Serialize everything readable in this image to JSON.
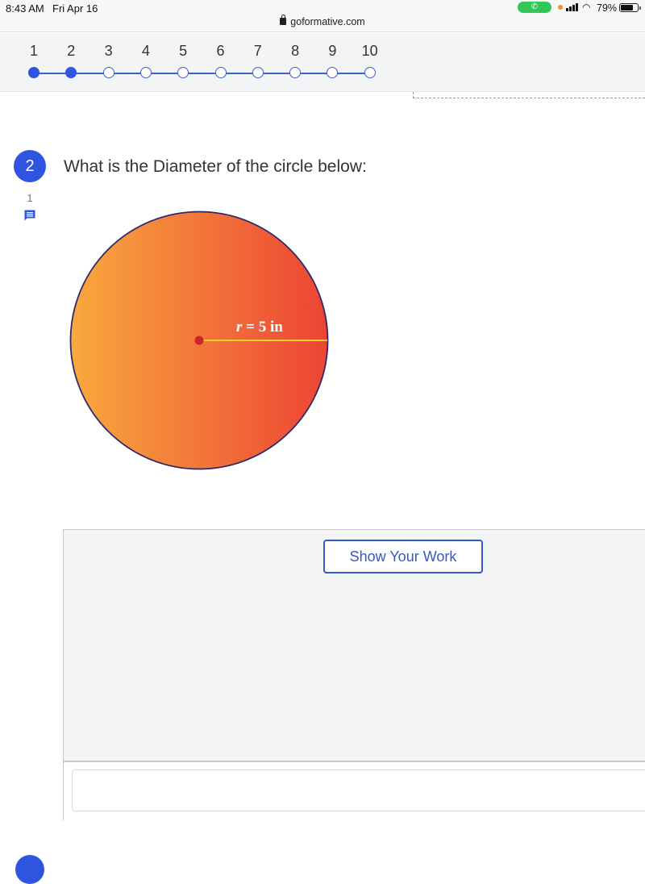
{
  "status_bar": {
    "time": "8:43 AM",
    "date": "Fri Apr 16",
    "url": "goformative.com",
    "call_icon": "phone-icon",
    "battery_percent": "79%",
    "battery_level": 0.79
  },
  "question_nav": {
    "steps": [
      {
        "label": "1",
        "state": "completed"
      },
      {
        "label": "2",
        "state": "completed"
      },
      {
        "label": "3",
        "state": "open"
      },
      {
        "label": "4",
        "state": "open"
      },
      {
        "label": "5",
        "state": "open"
      },
      {
        "label": "6",
        "state": "open"
      },
      {
        "label": "7",
        "state": "open"
      },
      {
        "label": "8",
        "state": "open"
      },
      {
        "label": "9",
        "state": "open"
      },
      {
        "label": "10",
        "state": "open"
      }
    ]
  },
  "question": {
    "number": "2",
    "text": "What is the Diameter of the circle below:",
    "comment_count": "1",
    "figure": {
      "radius_var": "r",
      "radius_rest": " = 5 in",
      "colors": {
        "fill_left": "#f9a93e",
        "fill_right": "#ec4434",
        "outline": "#2e2a6b",
        "radius_line": "#f6d02a",
        "center_dot": "#c9252c"
      }
    }
  },
  "answer": {
    "show_work_label": "Show Your Work",
    "input_value": "",
    "input_placeholder": ""
  },
  "colors": {
    "accent": "#2f55e0",
    "button_border": "#3557c7"
  }
}
